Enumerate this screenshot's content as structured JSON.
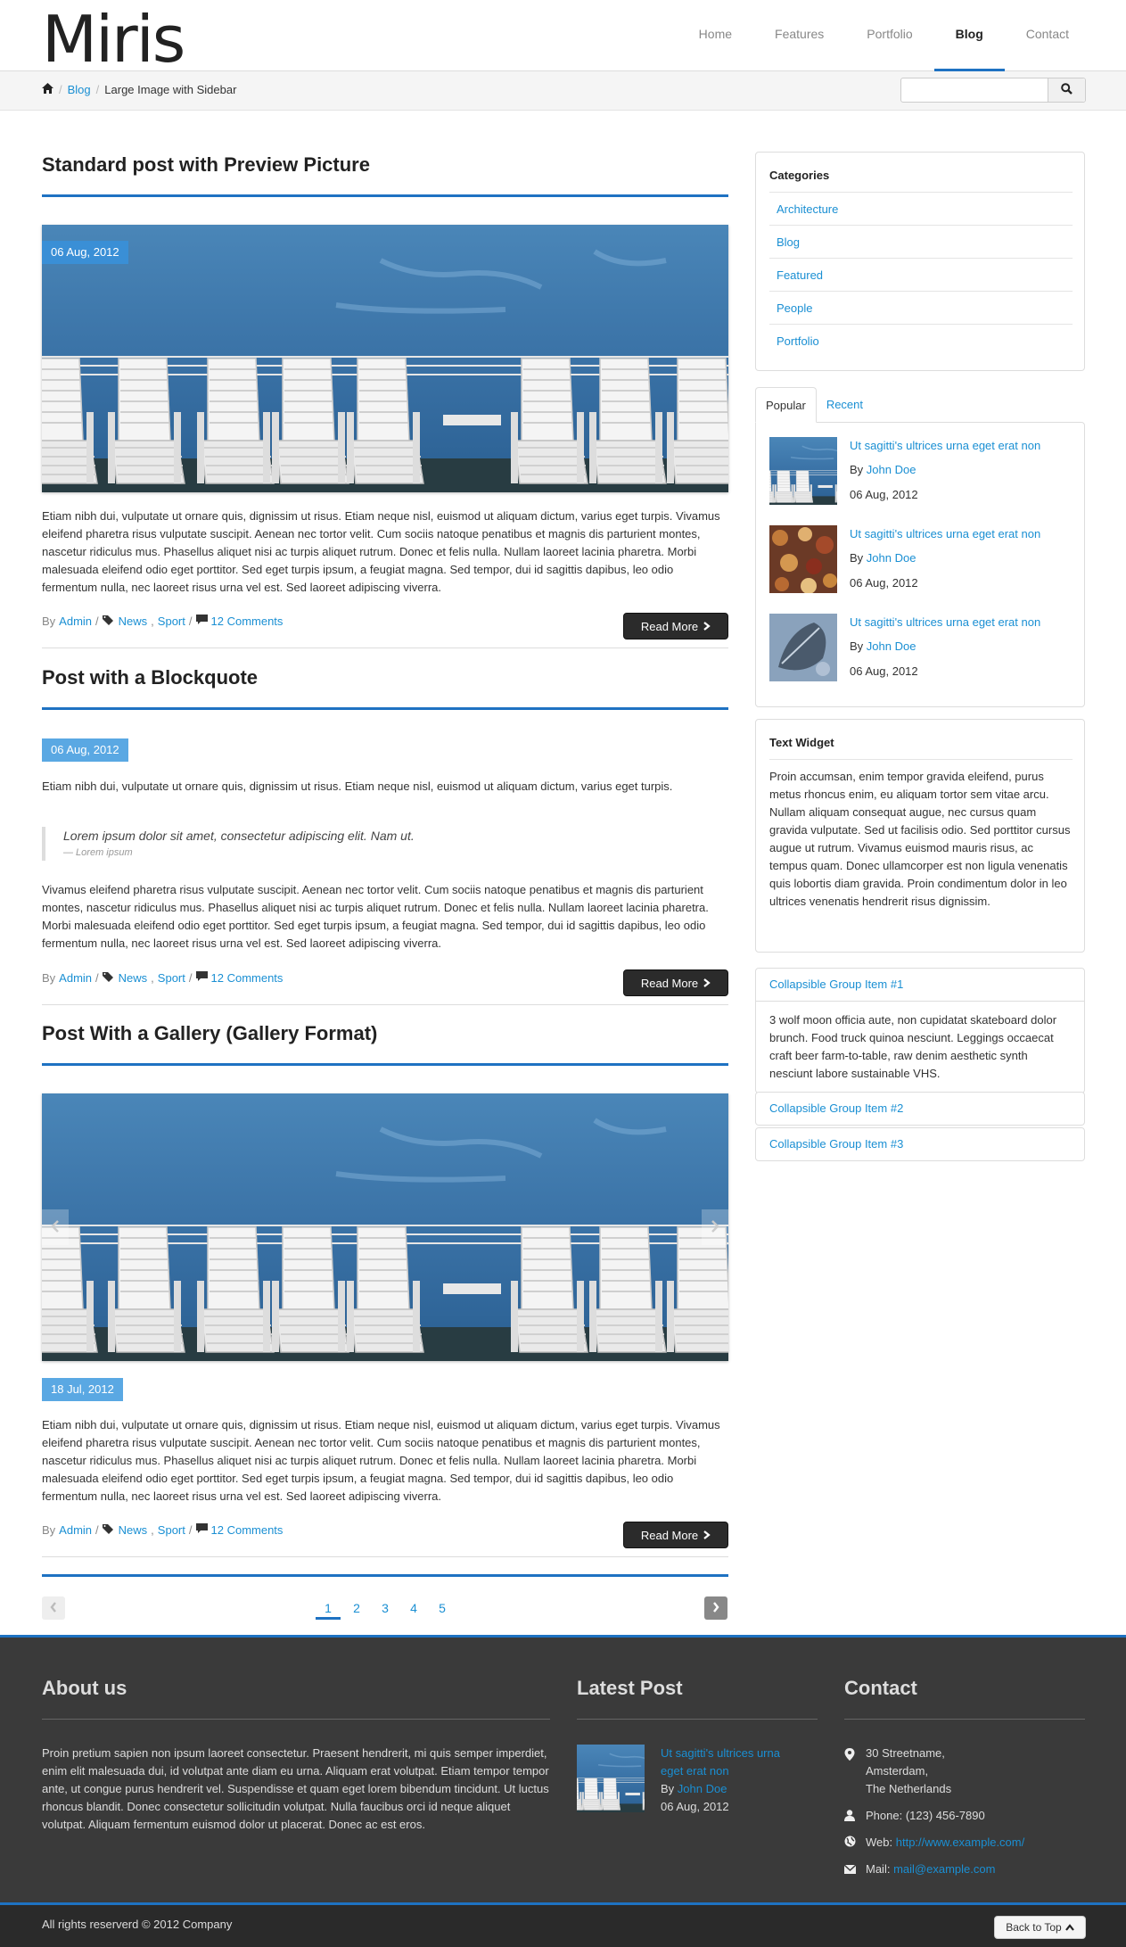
{
  "header": {
    "logo": "Miris",
    "nav": [
      "Home",
      "Features",
      "Portfolio",
      "Blog",
      "Contact"
    ],
    "active_nav": "Blog"
  },
  "breadcrumb": {
    "blog": "Blog",
    "current": "Large Image with Sidebar"
  },
  "search": {
    "placeholder": ""
  },
  "posts": [
    {
      "title": "Standard post with Preview Picture",
      "date": "06 Aug, 2012",
      "text": "Etiam nibh dui, vulputate ut ornare quis, dignissim ut risus. Etiam neque nisl, euismod ut aliquam dictum, varius eget turpis. Vivamus eleifend pharetra risus vulputate suscipit. Aenean nec tortor velit. Cum sociis natoque penatibus et magnis dis parturient montes, nascetur ridiculus mus. Phasellus aliquet nisi ac turpis aliquet rutrum. Donec et felis nulla. Nullam laoreet lacinia pharetra. Morbi malesuada eleifend odio eget porttitor. Sed eget turpis ipsum, a feugiat magna. Sed tempor, dui id sagittis dapibus, leo odio fermentum nulla, nec laoreet risus urna vel est. Sed laoreet adipiscing viverra.",
      "by": "By",
      "author": "Admin",
      "tag1": "News",
      "tag2": "Sport",
      "comments": "12 Comments",
      "readmore": "Read More"
    },
    {
      "title": "Post with a Blockquote",
      "date": "06 Aug, 2012",
      "text1": "Etiam nibh dui, vulputate ut ornare quis, dignissim ut risus. Etiam neque nisl, euismod ut aliquam dictum, varius eget turpis.",
      "quote": "Lorem ipsum dolor sit amet, consectetur adipiscing elit. Nam ut.",
      "cite": "— Lorem ipsum",
      "text2": "Vivamus eleifend pharetra risus vulputate suscipit. Aenean nec tortor velit. Cum sociis natoque penatibus et magnis dis parturient montes, nascetur ridiculus mus. Phasellus aliquet nisi ac turpis aliquet rutrum. Donec et felis nulla. Nullam laoreet lacinia pharetra. Morbi malesuada eleifend odio eget porttitor. Sed eget turpis ipsum, a feugiat magna. Sed tempor, dui id sagittis dapibus, leo odio fermentum nulla, nec laoreet risus urna vel est. Sed laoreet adipiscing viverra.",
      "by": "By",
      "author": "Admin",
      "tag1": "News",
      "tag2": "Sport",
      "comments": "12 Comments",
      "readmore": "Read More"
    },
    {
      "title": "Post With a Gallery (Gallery Format)",
      "date": "18 Jul, 2012",
      "text": "Etiam nibh dui, vulputate ut ornare quis, dignissim ut risus. Etiam neque nisl, euismod ut aliquam dictum, varius eget turpis. Vivamus eleifend pharetra risus vulputate suscipit. Aenean nec tortor velit. Cum sociis natoque penatibus et magnis dis parturient montes, nascetur ridiculus mus. Phasellus aliquet nisi ac turpis aliquet rutrum. Donec et felis nulla. Nullam laoreet lacinia pharetra. Morbi malesuada eleifend odio eget porttitor. Sed eget turpis ipsum, a feugiat magna. Sed tempor, dui id sagittis dapibus, leo odio fermentum nulla, nec laoreet risus urna vel est. Sed laoreet adipiscing viverra.",
      "by": "By",
      "author": "Admin",
      "tag1": "News",
      "tag2": "Sport",
      "comments": "12 Comments",
      "readmore": "Read More"
    }
  ],
  "pagination": [
    "1",
    "2",
    "3",
    "4",
    "5"
  ],
  "sidebar": {
    "categories_title": "Categories",
    "categories": [
      "Architecture",
      "Blog",
      "Featured",
      "People",
      "Portfolio"
    ],
    "tabs": [
      "Popular",
      "Recent"
    ],
    "popular": [
      {
        "title": "Ut sagitti's ultrices urna eget erat non",
        "by": "By",
        "author": "John Doe",
        "date": "06 Aug, 2012"
      },
      {
        "title": "Ut sagitti's ultrices urna eget erat non",
        "by": "By",
        "author": "John Doe",
        "date": "06 Aug, 2012"
      },
      {
        "title": "Ut sagitti's ultrices urna eget erat non",
        "by": "By",
        "author": "John Doe",
        "date": "06 Aug, 2012"
      }
    ],
    "text_widget_title": "Text Widget",
    "text_widget": "Proin accumsan, enim tempor gravida eleifend, purus metus rhoncus enim, eu aliquam tortor sem vitae arcu. Nullam aliquam consequat augue, nec cursus quam gravida vulputate. Sed ut facilisis odio. Sed porttitor cursus augue ut rutrum. Vivamus euismod mauris risus, ac tempus quam. Donec ullamcorper est non ligula venenatis quis lobortis diam gravida. Proin condimentum dolor in leo ultrices venenatis hendrerit risus dignissim.",
    "collapse": [
      {
        "title": "Collapsible Group Item #1",
        "body": "3 wolf moon officia aute, non cupidatat skateboard dolor brunch. Food truck quinoa nesciunt. Leggings occaecat craft beer farm-to-table, raw denim aesthetic synth nesciunt labore sustainable VHS."
      },
      {
        "title": "Collapsible Group Item #2"
      },
      {
        "title": "Collapsible Group Item #3"
      }
    ]
  },
  "footer": {
    "about_title": "About us",
    "about_text": "Proin pretium sapien non ipsum laoreet consectetur. Praesent hendrerit, mi quis semper imperdiet, enim elit malesuada dui, id volutpat ante diam eu urna. Aliquam erat volutpat. Etiam tempor tempor ante, ut congue purus hendrerit vel. Suspendisse et quam eget lorem bibendum tincidunt. Ut luctus rhoncus blandit. Donec consectetur sollicitudin volutpat. Nulla faucibus orci id neque aliquet volutpat. Aliquam fermentum euismod dolor ut placerat. Donec ac est eros.",
    "latest_title": "Latest Post",
    "latest": {
      "title": "Ut sagitti's ultrices urna eget erat non",
      "by": "By",
      "author": "John Doe",
      "date": "06 Aug, 2012"
    },
    "contact_title": "Contact",
    "address1": "30 Streetname,",
    "address2": "Amsterdam,",
    "address3": "The Netherlands",
    "phone_label": "Phone:",
    "phone": "(123) 456-7890",
    "web_label": "Web:",
    "web": "http://www.example.com/",
    "mail_label": "Mail:",
    "mail": "mail@example.com",
    "copyright": "All rights reserverd © 2012 Company",
    "back_to_top": "Back to Top"
  },
  "colors": {
    "accent": "#1e72c2",
    "link": "#1a8fd3",
    "footer_bg": "#3a3a3a"
  }
}
